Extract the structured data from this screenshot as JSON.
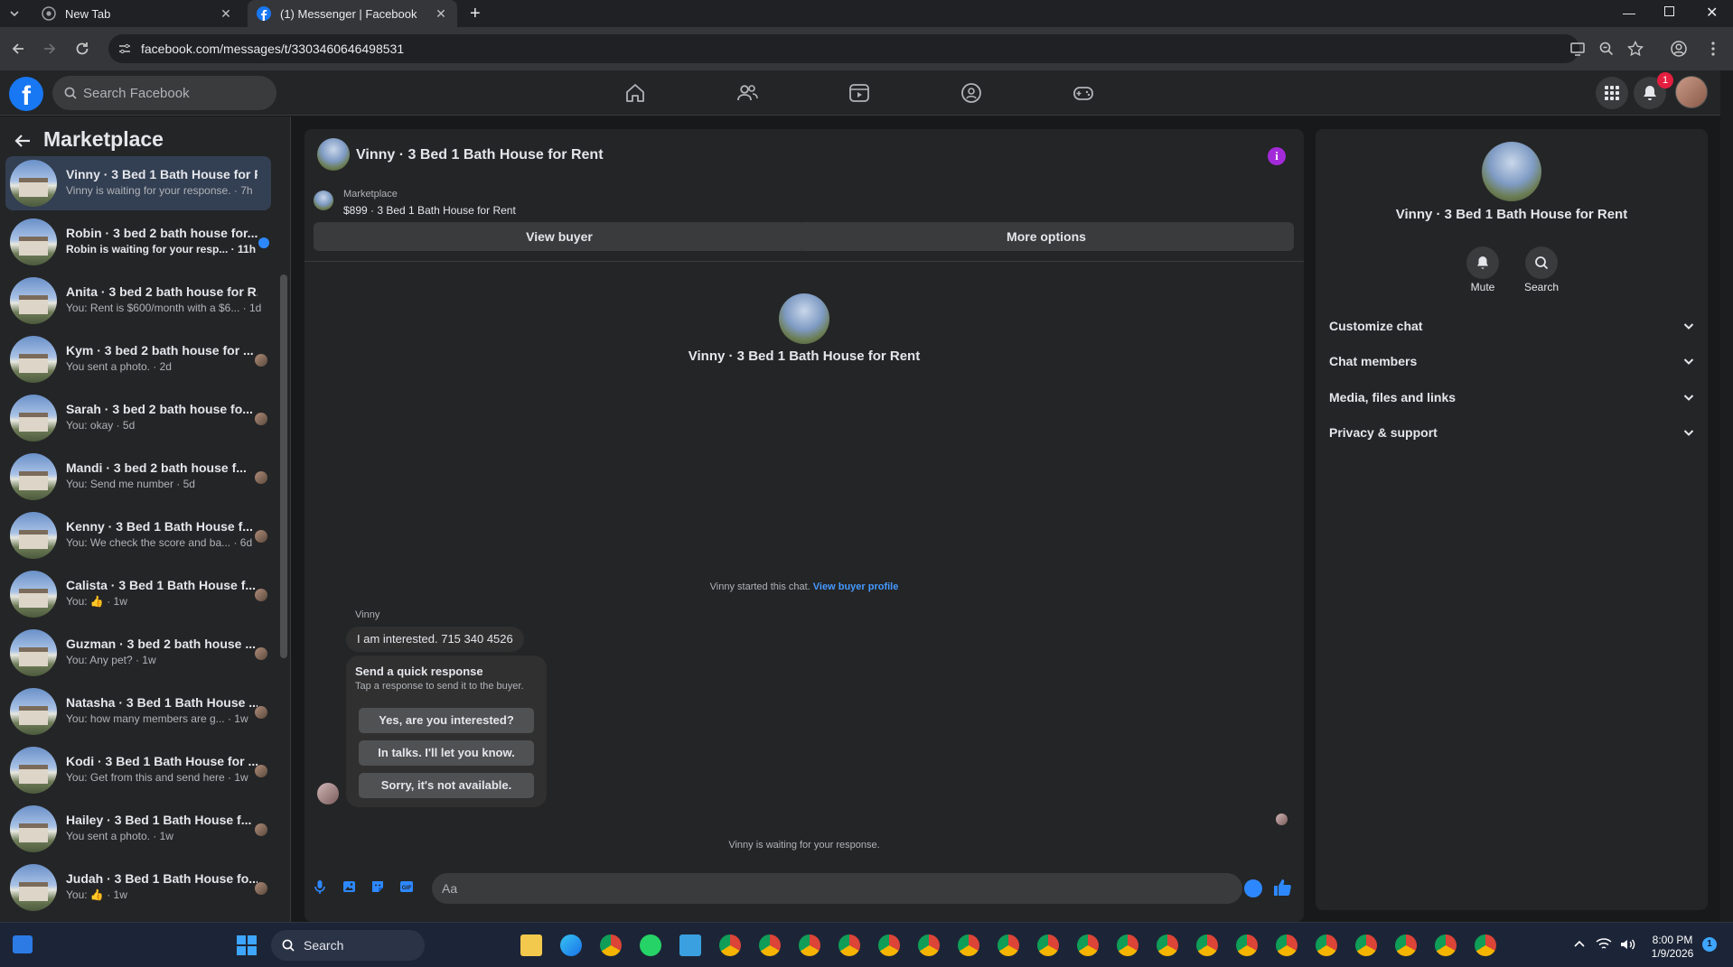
{
  "browser": {
    "tabs": [
      {
        "title": "New Tab"
      },
      {
        "title": "(1) Messenger | Facebook"
      }
    ],
    "url": "facebook.com/messages/t/3303460646498531"
  },
  "header": {
    "search_placeholder": "Search Facebook",
    "notification_count": "1"
  },
  "sidebar": {
    "title": "Marketplace",
    "conversations": [
      {
        "name": "Vinny · 3 Bed 1 Bath House for R...",
        "preview": "Vinny is waiting for your response. · 7h"
      },
      {
        "name": "Robin · 3 bed 2 bath house for...",
        "preview": "Robin is waiting for your resp... · 11h"
      },
      {
        "name": "Anita · 3 bed 2 bath house for R...",
        "preview": "You: Rent is $600/month with a $6... · 1d"
      },
      {
        "name": "Kym · 3 bed 2 bath house for ...",
        "preview": "You sent a photo. · 2d"
      },
      {
        "name": "Sarah · 3 bed 2 bath house fo...",
        "preview": "You: okay · 5d"
      },
      {
        "name": "Mandi · 3 bed 2 bath house f...",
        "preview": "You: Send me number · 5d"
      },
      {
        "name": "Kenny · 3 Bed 1 Bath House f...",
        "preview": "You: We check the score and ba... · 6d"
      },
      {
        "name": "Calista · 3 Bed 1 Bath House f...",
        "preview": "You: 👍 · 1w"
      },
      {
        "name": "Guzman · 3 bed 2 bath house ...",
        "preview": "You: Any pet? · 1w"
      },
      {
        "name": "Natasha · 3 Bed 1 Bath House ...",
        "preview": "You: how many members are g... · 1w"
      },
      {
        "name": "Kodi · 3 Bed 1 Bath House for ...",
        "preview": "You: Get from this and send here · 1w"
      },
      {
        "name": "Hailey · 3 Bed 1 Bath House f...",
        "preview": "You sent a photo. · 1w"
      },
      {
        "name": "Judah · 3 Bed 1 Bath House fo...",
        "preview": "You: 👍 · 1w"
      }
    ]
  },
  "chat": {
    "title": "Vinny · 3 Bed 1 Bath House for Rent",
    "marketplace_label": "Marketplace",
    "listing": "$899 · 3 Bed 1 Bath House for Rent",
    "view_buyer": "View buyer",
    "more_options": "More options",
    "big_name": "Vinny · 3 Bed 1 Bath House for Rent",
    "started_text": "Vinny started this chat.",
    "started_link": "View buyer profile",
    "sender": "Vinny",
    "message": "I am interested. 715 340 4526",
    "quick_title": "Send a quick response",
    "quick_sub": "Tap a response to send it to the buyer.",
    "quick_buttons": [
      "Yes, are you interested?",
      "In talks. I'll let you know.",
      "Sorry, it's not available."
    ],
    "waiting": "Vinny is waiting for your response.",
    "compose_placeholder": "Aa"
  },
  "info": {
    "name": "Vinny · 3 Bed 1 Bath House for Rent",
    "mute": "Mute",
    "search": "Search",
    "sections": [
      "Customize chat",
      "Chat members",
      "Media, files and links",
      "Privacy & support"
    ]
  },
  "taskbar": {
    "search": "Search",
    "time": "8:00 PM",
    "date": "1/9/2026"
  },
  "colors": {
    "accent": "#2d88ff",
    "fb_blue": "#1877f2",
    "active_row": "#333f52",
    "info_purple": "#a32ad9"
  }
}
